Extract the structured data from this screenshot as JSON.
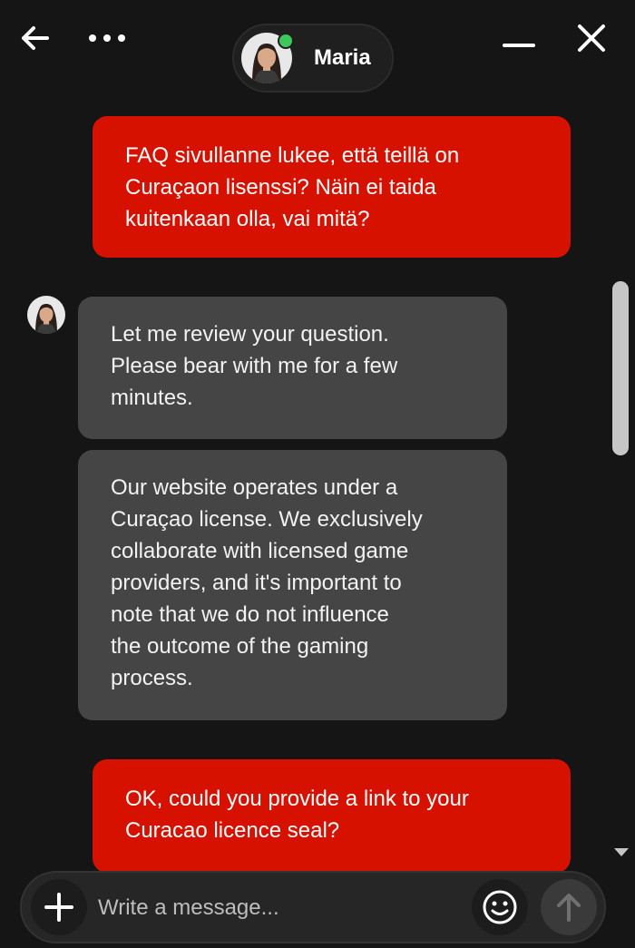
{
  "header": {
    "agent_name": "Maria",
    "agent_status": "online",
    "icons": {
      "back": "arrow-left-icon",
      "more": "more-horizontal-icon",
      "minimize": "minimize-icon",
      "close": "close-icon"
    }
  },
  "messages": [
    {
      "sender": "user",
      "lines": [
        "FAQ sivullanne lukee, että teillä on",
        "Curaçaon lisenssi? Näin ei taida",
        "kuitenkaan olla, vai mitä?"
      ]
    },
    {
      "sender": "agent",
      "lines": [
        "Let me review your question.",
        "Please bear with me for a few",
        "minutes."
      ]
    },
    {
      "sender": "agent",
      "lines": [
        "Our website operates under a",
        "Curaçao license. We exclusively",
        "collaborate with licensed game",
        "providers, and it's important to",
        "note that we do not influence",
        "the outcome of the gaming",
        "process."
      ]
    },
    {
      "sender": "user",
      "lines": [
        "OK, could you provide a link to your",
        "Curacao licence seal?"
      ]
    }
  ],
  "composer": {
    "placeholder": "Write a message...",
    "value": ""
  },
  "colors": {
    "user_bubble": "#d61100",
    "agent_bubble": "#454545",
    "background": "#151515",
    "online": "#3ec85b"
  }
}
